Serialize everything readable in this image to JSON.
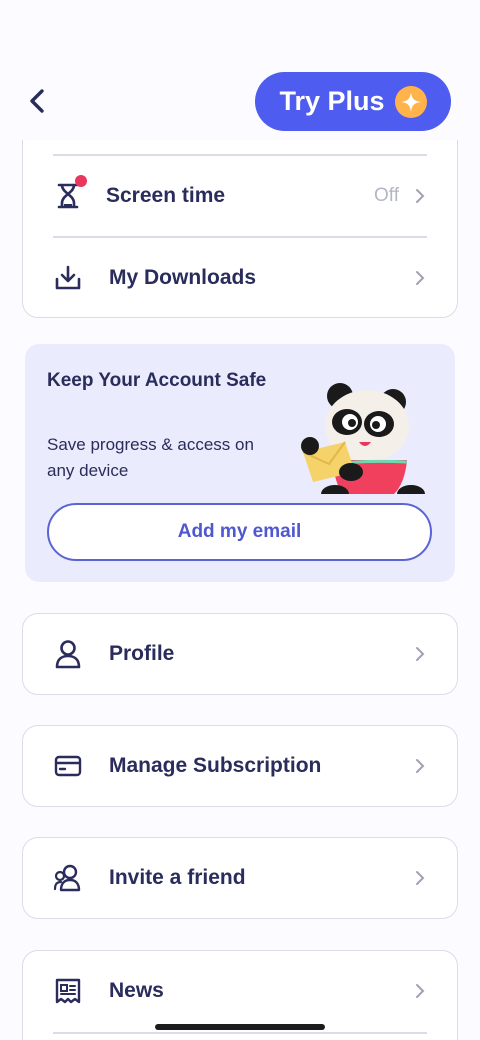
{
  "header": {
    "try_plus_label": "Try Plus"
  },
  "settings_top": {
    "screen_time": {
      "label": "Screen time",
      "value": "Off"
    },
    "downloads": {
      "label": "My Downloads"
    }
  },
  "safe_card": {
    "title": "Keep Your Account Safe",
    "subtitle": "Save progress & access on any device",
    "button_label": "Add my email"
  },
  "menu": {
    "profile": "Profile",
    "subscription": "Manage Subscription",
    "invite": "Invite a friend",
    "news": "News"
  },
  "colors": {
    "accent": "#4f5cf0",
    "notification_dot": "#e8365c",
    "card_bg": "#eaebfd"
  }
}
